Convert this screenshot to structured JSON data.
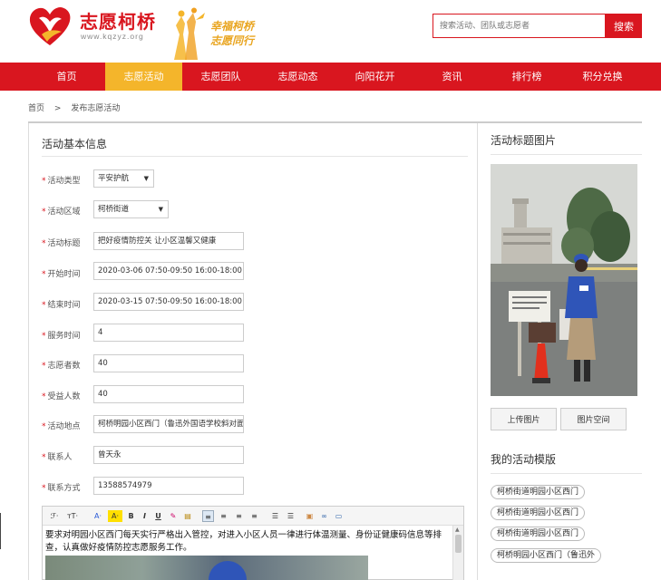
{
  "header": {
    "site_title": "志愿柯桥",
    "site_url": "www.kqzyz.org",
    "slogan_line1": "幸福柯桥",
    "slogan_line2": "志愿同行",
    "search_placeholder": "搜索活动、团队或志愿者",
    "search_button": "搜索",
    "brand_color": "#d9161f",
    "accent_color": "#f4b52b"
  },
  "nav": {
    "items": [
      "首页",
      "志愿活动",
      "志愿团队",
      "志愿动态",
      "向阳花开",
      "资讯",
      "排行榜",
      "积分兑换"
    ],
    "active": "志愿活动"
  },
  "breadcrumb": {
    "home": "首页",
    "separator": ">",
    "current": "发布志愿活动"
  },
  "form": {
    "section_title": "活动基本信息",
    "required_mark": "*",
    "fields": {
      "type": {
        "label": "活动类型",
        "value": "平安护航"
      },
      "area": {
        "label": "活动区域",
        "value": "柯桥街道"
      },
      "title": {
        "label": "活动标题",
        "value": "把好疫情防控关 让小区温馨又健康"
      },
      "start": {
        "label": "开始时间",
        "value": "2020-03-06 07:50-09:50   16:00-18:00"
      },
      "end": {
        "label": "结束时间",
        "value": "2020-03-15 07:50-09:50  16:00-18:00"
      },
      "hours": {
        "label": "服务时间",
        "value": "4"
      },
      "volunteers": {
        "label": "志愿者数",
        "value": "40"
      },
      "beneficiaries": {
        "label": "受益人数",
        "value": "40"
      },
      "location": {
        "label": "活动地点",
        "value": "柯桥明园小区西门（鲁迅外国语学校斜对面"
      },
      "contact": {
        "label": "联系人",
        "value": "曾天永"
      },
      "phone": {
        "label": "联系方式",
        "value": "13588574979"
      }
    },
    "caret": "▼"
  },
  "editor": {
    "toolbar": {
      "font_family": "ℱ·",
      "font_size": "тT·",
      "font_color": "A·",
      "highlight": "A·",
      "bold": "B",
      "italic": "I",
      "underline": "U",
      "eraser": "✎",
      "paste": "▤",
      "align_left": "≡",
      "align_center": "≡",
      "align_right": "≡",
      "justify": "≡",
      "ordered_list": "☰",
      "unordered_list": "☰",
      "image": "▣",
      "link": "∞",
      "fullscreen": "▭"
    },
    "content": "要求对明园小区西门每天实行严格出入管控，对进入小区人员一律进行体温测量、身份证健康码信息等排查，认真做好疫情防控志愿服务工作。"
  },
  "sidebar": {
    "image_title": "活动标题图片",
    "upload_button": "上传图片",
    "gallery_button": "图片空间",
    "templates_title": "我的活动模版",
    "templates": [
      "柯桥街道明园小区西门",
      "柯桥街道明园小区西门",
      "柯桥街道明园小区西门",
      "柯桥明园小区西门（鲁迅外"
    ]
  }
}
